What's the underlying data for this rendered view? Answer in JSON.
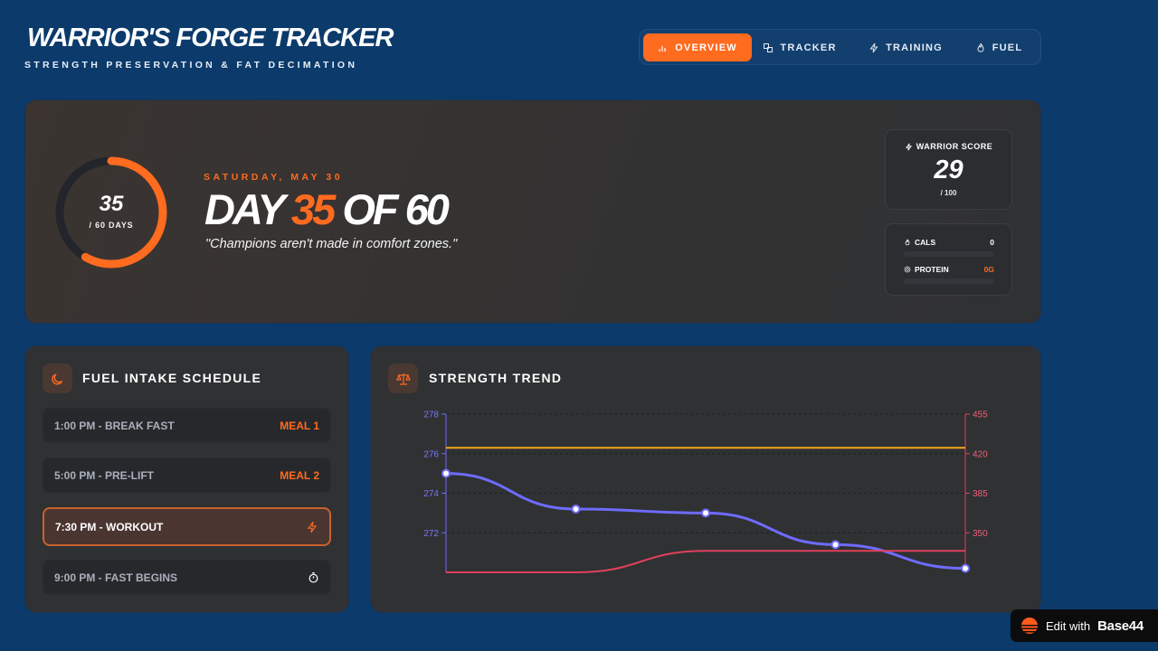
{
  "header": {
    "title": "WARRIOR'S FORGE TRACKER",
    "subtitle": "STRENGTH PRESERVATION & FAT DECIMATION"
  },
  "nav": {
    "tabs": [
      {
        "label": "OVERVIEW",
        "icon": "bar-chart-icon",
        "active": true
      },
      {
        "label": "TRACKER",
        "icon": "tracker-icon",
        "active": false
      },
      {
        "label": "TRAINING",
        "icon": "bolt-icon",
        "active": false
      },
      {
        "label": "FUEL",
        "icon": "flame-icon",
        "active": false
      }
    ]
  },
  "hero": {
    "ring_value": "35",
    "ring_label": "/ 60 DAYS",
    "progress": 0.5833,
    "date": "SATURDAY, MAY 30",
    "day_prefix": "DAY",
    "day_current": "35",
    "day_suffix": "OF 60",
    "quote": "\"Champions aren't made in comfort zones.\"",
    "score_label": "WARRIOR SCORE",
    "score_value": "29",
    "score_max": "/ 100",
    "macros": [
      {
        "name": "CALS",
        "icon": "flame-icon",
        "value": "0",
        "value_color": "#ffffff"
      },
      {
        "name": "PROTEIN",
        "icon": "target-icon",
        "value": "0G",
        "value_color": "#ff6b1f"
      }
    ]
  },
  "schedule": {
    "title": "FUEL INTAKE SCHEDULE",
    "icon": "moon-icon",
    "items": [
      {
        "label": "1:00 PM - BREAK FAST",
        "tag": "MEAL 1",
        "active": false
      },
      {
        "label": "5:00 PM - PRE-LIFT",
        "tag": "MEAL 2",
        "active": false
      },
      {
        "label": "7:30 PM - WORKOUT",
        "tag": "",
        "icon": "bolt-icon",
        "active": true
      },
      {
        "label": "9:00 PM - FAST BEGINS",
        "tag": "",
        "icon": "stopwatch-icon",
        "active": false
      }
    ]
  },
  "trend": {
    "title": "STRENGTH TREND",
    "icon": "scale-icon"
  },
  "colors": {
    "background": "#0b3a6b",
    "accent": "#ff6b1f",
    "weight_line": "#6f6bff",
    "strength_line": "#e0405c",
    "target_line": "#f5a623"
  },
  "chart_data": {
    "type": "line",
    "x": [
      1,
      2,
      3,
      4,
      5
    ],
    "left_axis": {
      "ticks": [
        272,
        274,
        276,
        278
      ],
      "ylim": [
        270,
        278
      ]
    },
    "right_axis": {
      "ticks": [
        350,
        385,
        420,
        455
      ],
      "ylim": [
        315,
        455
      ]
    },
    "series": [
      {
        "axis": "left",
        "values": [
          275,
          273.2,
          273,
          271.4,
          270.2
        ],
        "markers": true,
        "color": "#6f6bff"
      },
      {
        "axis": "right",
        "values": [
          315,
          315,
          334,
          334,
          334
        ],
        "markers": false,
        "color": "#e0405c"
      },
      {
        "axis": "left",
        "values": [
          276.3,
          276.3,
          276.3,
          276.3,
          276.3
        ],
        "markers": false,
        "color": "#f5a623"
      }
    ],
    "grid": true
  },
  "badge": {
    "text": "Edit with",
    "brand": "Base44"
  }
}
